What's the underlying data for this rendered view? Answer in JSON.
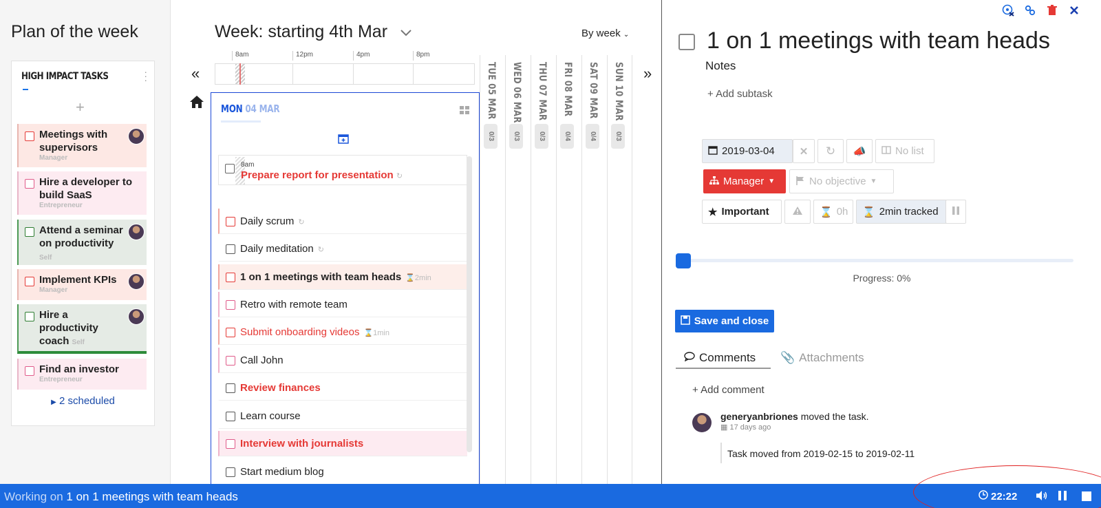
{
  "left": {
    "title": "Plan of the week",
    "card_title": "HIGH IMPACT TASKS",
    "add_symbol": "+",
    "items": [
      {
        "label": "Meetings with supervisors",
        "tag": "Manager"
      },
      {
        "label": "Hire a developer to build SaaS",
        "tag": "Entrepreneur"
      },
      {
        "label": "Attend a seminar on productivity",
        "tag": "Self"
      },
      {
        "label": "Implement KPIs",
        "tag": "Manager"
      },
      {
        "label": "Hire a productivity coach",
        "tag": "Self"
      },
      {
        "label": "Find an investor",
        "tag": "Entrepreneur"
      }
    ],
    "scheduled": "2 scheduled"
  },
  "middle": {
    "week_title": "Week: starting 4th Mar",
    "view_select": "By week",
    "timeline_hours": [
      "8am",
      "12pm",
      "4pm",
      "8pm"
    ],
    "day_label": "MON",
    "day_date": "04 MAR",
    "first_task": {
      "time": "8am",
      "label": "Prepare report for presentation"
    },
    "tasks": [
      {
        "label": "Daily scrum",
        "meta": "↻"
      },
      {
        "label": "Daily meditation",
        "meta": "↻"
      },
      {
        "label": "1 on 1 meetings with team heads",
        "meta": "⌛2min"
      },
      {
        "label": "Retro with remote team",
        "meta": ""
      },
      {
        "label": "Submit onboarding videos",
        "meta": "⌛1min"
      },
      {
        "label": "Call John",
        "meta": ""
      },
      {
        "label": "Review finances",
        "meta": ""
      },
      {
        "label": "Learn course",
        "meta": ""
      },
      {
        "label": "Interview with journalists",
        "meta": ""
      },
      {
        "label": "Start medium blog",
        "meta": ""
      }
    ],
    "other_days": [
      {
        "label": "TUE 05 MAR",
        "count": "0/3"
      },
      {
        "label": "WED 06 MAR",
        "count": "0/3"
      },
      {
        "label": "THU 07 MAR",
        "count": "0/3"
      },
      {
        "label": "FRI 08 MAR",
        "count": "0/4"
      },
      {
        "label": "SAT 09 MAR",
        "count": "0/4"
      },
      {
        "label": "SUN 10 MAR",
        "count": "0/3"
      }
    ]
  },
  "detail": {
    "title": "1 on 1 meetings with team heads",
    "notes": "Notes",
    "add_subtask": "+ Add subtask",
    "date": "2019-03-04",
    "list": "No list",
    "role": "Manager",
    "objective": "No objective",
    "important": "Important",
    "estimate": "0h",
    "tracked": "2min tracked",
    "progress_value": 0,
    "progress_label": "Progress: 0%",
    "save_label": "Save and close",
    "tabs": {
      "comments": "Comments",
      "attachments": "Attachments"
    },
    "add_comment": "+ Add comment",
    "comment": {
      "user": "generyanbriones",
      "action": "moved the task.",
      "time": "17 days ago",
      "body": "Task moved from 2019-02-15 to 2019-02-11"
    }
  },
  "statusbar": {
    "prefix": "Working on",
    "task": "1 on 1 meetings with team heads",
    "timer": "22:22"
  },
  "colors": {
    "accent": "#1a6ae0",
    "danger": "#e53935",
    "role_manager": "#e53935"
  }
}
